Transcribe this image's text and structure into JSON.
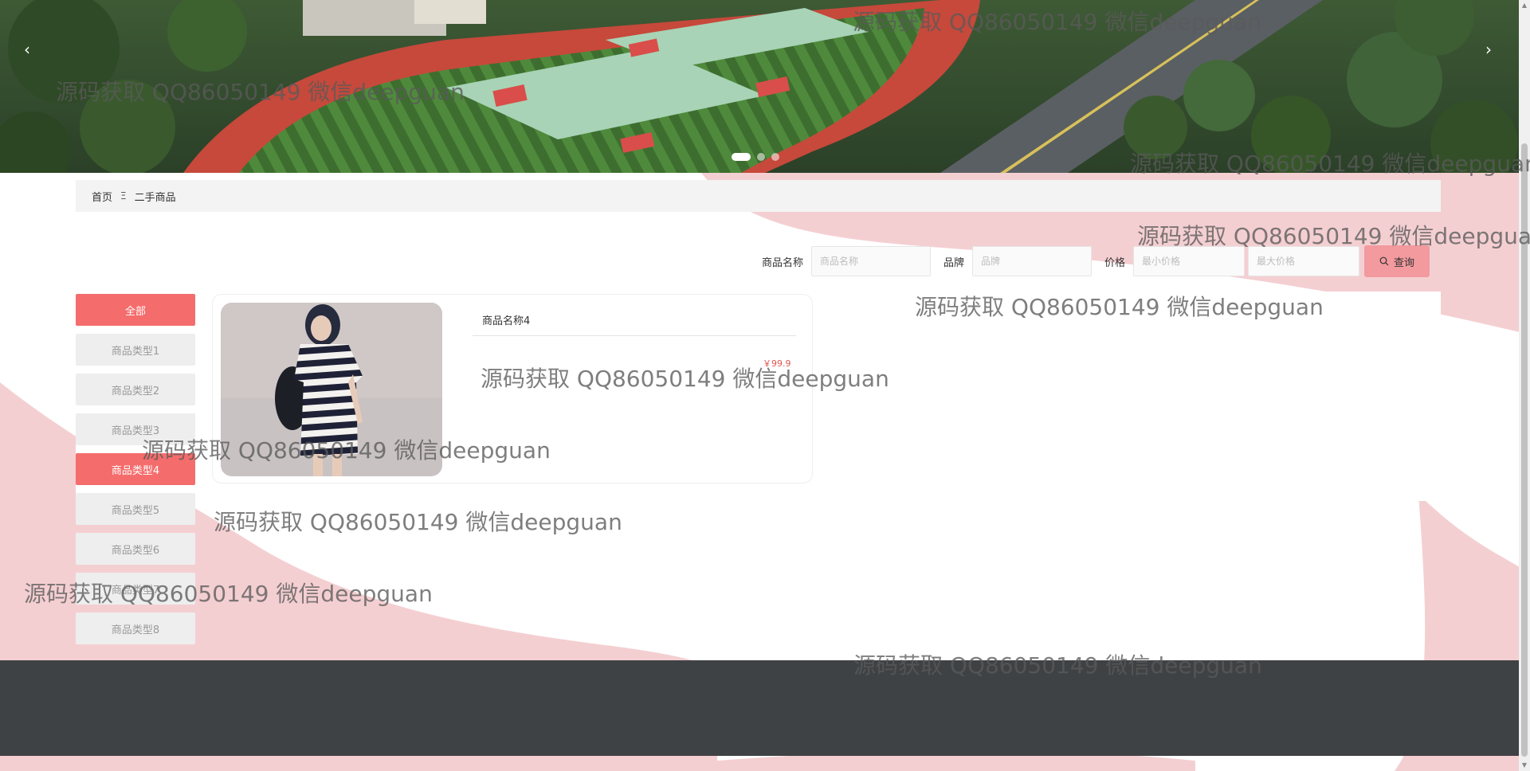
{
  "banner": {
    "prev_arrow": "‹",
    "next_arrow": "›",
    "dots": 3,
    "active_dot": 0
  },
  "breadcrumb": {
    "home": "首页",
    "separator": "Ξ",
    "current": "二手商品"
  },
  "search": {
    "name_label": "商品名称",
    "name_placeholder": "商品名称",
    "brand_label": "品牌",
    "brand_placeholder": "品牌",
    "price_label": "价格",
    "min_price_placeholder": "最小价格",
    "max_price_placeholder": "最大价格",
    "button_label": "查询"
  },
  "categories": [
    {
      "label": "全部",
      "active": true
    },
    {
      "label": "商品类型1",
      "active": false
    },
    {
      "label": "商品类型2",
      "active": false
    },
    {
      "label": "商品类型3",
      "active": false
    },
    {
      "label": "商品类型4",
      "active": true
    },
    {
      "label": "商品类型5",
      "active": false
    },
    {
      "label": "商品类型6",
      "active": false
    },
    {
      "label": "商品类型7",
      "active": false
    },
    {
      "label": "商品类型8",
      "active": false
    }
  ],
  "product": {
    "name": "商品名称4",
    "price": "￥99.9"
  },
  "watermark_text": "源码获取 QQ86050149 微信deepguan",
  "colors": {
    "accent": "#f56c6c",
    "search_button": "#f29a9e",
    "footer": "#3f4244",
    "wave": "#f4cfd2",
    "price": "#e0554f"
  }
}
